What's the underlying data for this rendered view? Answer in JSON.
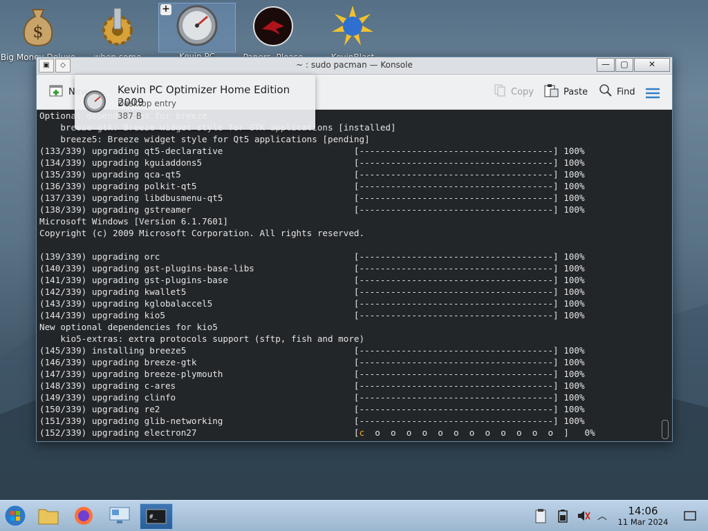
{
  "desktop": {
    "icons": [
      {
        "label": "Big Money Deluxe",
        "icon": "money-bag-icon"
      },
      {
        "label": "when some russian runs a",
        "icon": "gear-icon"
      },
      {
        "label": "Kevin PC Optimizer Ho",
        "icon": "gauge-icon"
      },
      {
        "label": "Papers, Please",
        "icon": "eagle-icon"
      },
      {
        "label": "KevinBlast Launcher",
        "icon": "burst-disc-icon"
      }
    ],
    "add_badge": "+"
  },
  "window": {
    "title": "~ : sudo pacman — Konsole",
    "left_buttons": [
      "▣",
      "◇"
    ],
    "buttons": {
      "minimize": "—",
      "maximize": "▢",
      "close": "✕"
    }
  },
  "toolbar": {
    "new_label": "New",
    "copy_label": "Copy",
    "paste_label": "Paste",
    "find_label": "Find",
    "menu_icon": "hamburger-menu-icon"
  },
  "tooltip": {
    "title": "Kevin PC Optimizer Home Edition 2009",
    "type": "Desktop entry",
    "size": "387 B"
  },
  "terminal": {
    "lines": [
      {
        "text": "Optional dependencies for breeze"
      },
      {
        "text": "    breeze-gtk: Breeze widget style for GTK applications [installed]"
      },
      {
        "text": "    breeze5: Breeze widget style for Qt5 applications [pending]"
      },
      {
        "text": "(133/339) upgrading qt5-declarative                         [-------------------------------------] 100%"
      },
      {
        "text": "(134/339) upgrading kguiaddons5                             [-------------------------------------] 100%"
      },
      {
        "text": "(135/339) upgrading qca-qt5                                 [-------------------------------------] 100%"
      },
      {
        "text": "(136/339) upgrading polkit-qt5                              [-------------------------------------] 100%"
      },
      {
        "text": "(137/339) upgrading libdbusmenu-qt5                         [-------------------------------------] 100%"
      },
      {
        "text": "(138/339) upgrading gstreamer                               [-------------------------------------] 100%"
      },
      {
        "text": "Microsoft Windows [Version 6.1.7601]"
      },
      {
        "text": "Copyright (c) 2009 Microsoft Corporation. All rights reserved."
      },
      {
        "text": ""
      },
      {
        "text": "(139/339) upgrading orc                                     [-------------------------------------] 100%"
      },
      {
        "text": "(140/339) upgrading gst-plugins-base-libs                   [-------------------------------------] 100%"
      },
      {
        "text": "(141/339) upgrading gst-plugins-base                        [-------------------------------------] 100%"
      },
      {
        "text": "(142/339) upgrading kwallet5                                [-------------------------------------] 100%"
      },
      {
        "text": "(143/339) upgrading kglobalaccel5                           [-------------------------------------] 100%"
      },
      {
        "text": "(144/339) upgrading kio5                                    [-------------------------------------] 100%"
      },
      {
        "text": "New optional dependencies for kio5"
      },
      {
        "text": "    kio5-extras: extra protocols support (sftp, fish and more)"
      },
      {
        "text": "(145/339) installing breeze5                                [-------------------------------------] 100%"
      },
      {
        "text": "(146/339) upgrading breeze-gtk                              [-------------------------------------] 100%"
      },
      {
        "text": "(147/339) upgrading breeze-plymouth                         [-------------------------------------] 100%"
      },
      {
        "text": "(148/339) upgrading c-ares                                  [-------------------------------------] 100%"
      },
      {
        "text": "(149/339) upgrading clinfo                                  [-------------------------------------] 100%"
      },
      {
        "text": "(150/339) upgrading re2                                     [-------------------------------------] 100%"
      },
      {
        "text": "(151/339) upgrading glib-networking                         [-------------------------------------] 100%"
      },
      {
        "text": "(152/339) upgrading electron27                              [c  o  o  o  o  o  o  o  o  o  o  o  o  ]   0%"
      }
    ]
  },
  "taskbar": {
    "items": [
      "start-orb-icon",
      "file-manager-icon",
      "firefox-icon",
      "system-settings-icon",
      "konsole-icon"
    ],
    "tray": [
      "clipboard-icon",
      "battery-icon",
      "muted-speaker-icon",
      "tray-expand-icon"
    ],
    "tray_expand": "︿",
    "time": "14:06",
    "date": "11 Mar 2024"
  },
  "colors": {
    "terminal_bg": "#232629",
    "accent": "#3d8bd6",
    "pacman": "#f5a623"
  }
}
